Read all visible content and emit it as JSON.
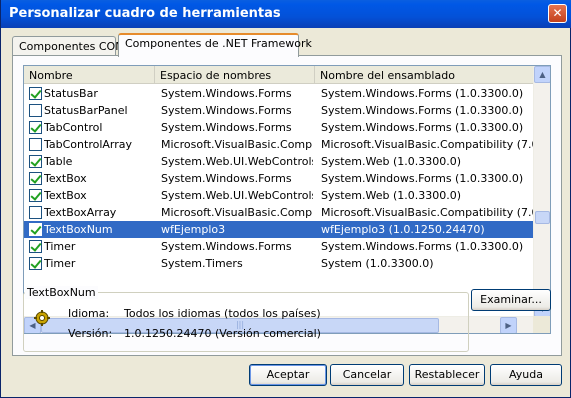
{
  "window": {
    "title": "Personalizar cuadro de herramientas",
    "close_label": "✕"
  },
  "tabs": [
    {
      "label": "Componentes COM",
      "active": false
    },
    {
      "label": "Componentes de .NET Framework",
      "active": true
    }
  ],
  "list": {
    "columns": [
      "Nombre",
      "Espacio de nombres",
      "Nombre del ensamblado"
    ],
    "rows": [
      {
        "checked": true,
        "name": "StatusBar",
        "namespace": "System.Windows.Forms",
        "assembly": "System.Windows.Forms (1.0.3300.0)",
        "selected": false
      },
      {
        "checked": false,
        "name": "StatusBarPanel",
        "namespace": "System.Windows.Forms",
        "assembly": "System.Windows.Forms (1.0.3300.0)",
        "selected": false
      },
      {
        "checked": true,
        "name": "TabControl",
        "namespace": "System.Windows.Forms",
        "assembly": "System.Windows.Forms (1.0.3300.0)",
        "selected": false
      },
      {
        "checked": false,
        "name": "TabControlArray",
        "namespace": "Microsoft.VisualBasic.Comp...",
        "assembly": "Microsoft.VisualBasic.Compatibility (7.0...",
        "selected": false
      },
      {
        "checked": true,
        "name": "Table",
        "namespace": "System.Web.UI.WebControls",
        "assembly": "System.Web (1.0.3300.0)",
        "selected": false
      },
      {
        "checked": true,
        "name": "TextBox",
        "namespace": "System.Windows.Forms",
        "assembly": "System.Windows.Forms (1.0.3300.0)",
        "selected": false
      },
      {
        "checked": true,
        "name": "TextBox",
        "namespace": "System.Web.UI.WebControls",
        "assembly": "System.Web (1.0.3300.0)",
        "selected": false
      },
      {
        "checked": false,
        "name": "TextBoxArray",
        "namespace": "Microsoft.VisualBasic.Comp...",
        "assembly": "Microsoft.VisualBasic.Compatibility (7.0...",
        "selected": false
      },
      {
        "checked": true,
        "name": "TextBoxNum",
        "namespace": "wfEjemplo3",
        "assembly": "wfEjemplo3 (1.0.1250.24470)",
        "selected": true
      },
      {
        "checked": true,
        "name": "Timer",
        "namespace": "System.Windows.Forms",
        "assembly": "System.Windows.Forms (1.0.3300.0)",
        "selected": false
      },
      {
        "checked": true,
        "name": "Timer",
        "namespace": "System.Timers",
        "assembly": "System (1.0.3300.0)",
        "selected": false
      }
    ]
  },
  "details": {
    "group_title": "TextBoxNum",
    "language_label": "Idioma:",
    "language_value": "Todos los idiomas (todos los países)",
    "version_label": "Versión:",
    "version_value": "1.0.1250.24470 (Versión comercial)"
  },
  "buttons": {
    "browse": "Examinar...",
    "ok": "Aceptar",
    "cancel": "Cancelar",
    "reset": "Restablecer",
    "help": "Ayuda"
  },
  "colors": {
    "selection": "#316ac5",
    "titlebar": "#0351d8",
    "check": "#21a121"
  },
  "icons": {
    "component_icon": "gear-icon"
  }
}
